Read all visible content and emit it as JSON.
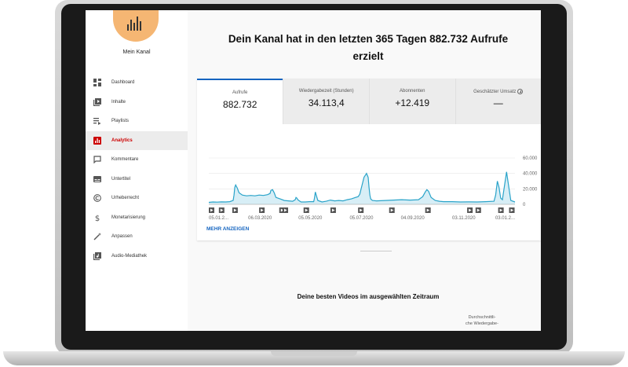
{
  "sidebar": {
    "channel_name": "Mein Kanal",
    "items": [
      {
        "label": "Dashboard",
        "icon": "dashboard-icon"
      },
      {
        "label": "Inhalte",
        "icon": "video-library-icon"
      },
      {
        "label": "Playlists",
        "icon": "playlist-icon"
      },
      {
        "label": "Analytics",
        "icon": "analytics-icon",
        "active": true
      },
      {
        "label": "Kommentare",
        "icon": "comment-icon"
      },
      {
        "label": "Untertitel",
        "icon": "subtitles-icon"
      },
      {
        "label": "Urheberrecht",
        "icon": "copyright-icon"
      },
      {
        "label": "Monetarisierung",
        "icon": "dollar-icon"
      },
      {
        "label": "Anpassen",
        "icon": "magic-wand-icon"
      },
      {
        "label": "Audio-Mediathek",
        "icon": "music-library-icon"
      }
    ]
  },
  "headline": "Dein Kanal hat in den letzten 365 Tagen 882.732 Aufrufe erzielt",
  "tabs": [
    {
      "label": "Aufrufe",
      "value": "882.732"
    },
    {
      "label": "Wiedergabezeit (Stunden)",
      "value": "34.113,4"
    },
    {
      "label": "Abonnenten",
      "value": "+12.419"
    },
    {
      "label": "Geschätzter Umsatz",
      "value": "—"
    }
  ],
  "more_link": "MEHR ANZEIGEN",
  "sub_headline": "Deine besten Videos im ausgewählten Zeitraum",
  "column_header_line1": "Durchschnittli-",
  "column_header_line2": "che Wiedergabe-",
  "colors": {
    "accent": "#1565c0",
    "line": "#29a3c9",
    "active_nav": "#cc0000",
    "avatar": "#f5b673"
  },
  "chart_data": {
    "type": "area",
    "y_ticks": [
      "60.000",
      "40.000",
      "20.000",
      "0"
    ],
    "ylim": [
      0,
      60000
    ],
    "x_tick_labels": [
      "05.01.2...",
      "06.03.2020",
      "05.05.2020",
      "05.07.2020",
      "04.09.2020",
      "03.11.2020",
      "03.01.2..."
    ],
    "x": [
      0,
      5,
      10,
      15,
      20,
      25,
      29,
      30,
      31,
      32,
      34,
      36,
      40,
      45,
      50,
      55,
      60,
      65,
      70,
      73,
      74,
      76,
      78,
      80,
      85,
      90,
      95,
      100,
      103,
      104,
      105,
      106,
      108,
      110,
      115,
      120,
      125,
      126,
      127,
      128,
      130,
      135,
      140,
      145,
      150,
      155,
      160,
      165,
      170,
      175,
      178,
      180,
      182,
      185,
      188,
      190,
      191,
      192,
      193,
      195,
      200,
      210,
      220,
      230,
      240,
      250,
      255,
      258,
      260,
      262,
      265,
      270,
      275,
      280,
      290,
      300,
      310,
      320,
      330,
      340,
      342,
      344,
      346,
      348,
      350,
      355,
      360,
      365
    ],
    "values": [
      2500,
      3000,
      2800,
      3200,
      3000,
      3500,
      5000,
      12000,
      22000,
      25000,
      21000,
      15000,
      12000,
      11000,
      11500,
      11000,
      12000,
      11500,
      12500,
      14000,
      18000,
      19000,
      15000,
      9000,
      7000,
      5000,
      4500,
      4000,
      6000,
      9000,
      8000,
      6000,
      4500,
      3000,
      3000,
      3500,
      3500,
      8000,
      16000,
      12000,
      5000,
      3000,
      4000,
      5500,
      4500,
      5000,
      4500,
      6000,
      7000,
      9000,
      10000,
      13000,
      22000,
      35000,
      40000,
      35000,
      22000,
      12000,
      7000,
      5000,
      4500,
      5000,
      5500,
      6000,
      5500,
      6000,
      10000,
      16000,
      19000,
      17000,
      9000,
      5000,
      4000,
      3500,
      3500,
      3000,
      3200,
      3000,
      3500,
      4000,
      12000,
      30000,
      22000,
      8000,
      6000,
      42000,
      5000,
      3000
    ]
  }
}
